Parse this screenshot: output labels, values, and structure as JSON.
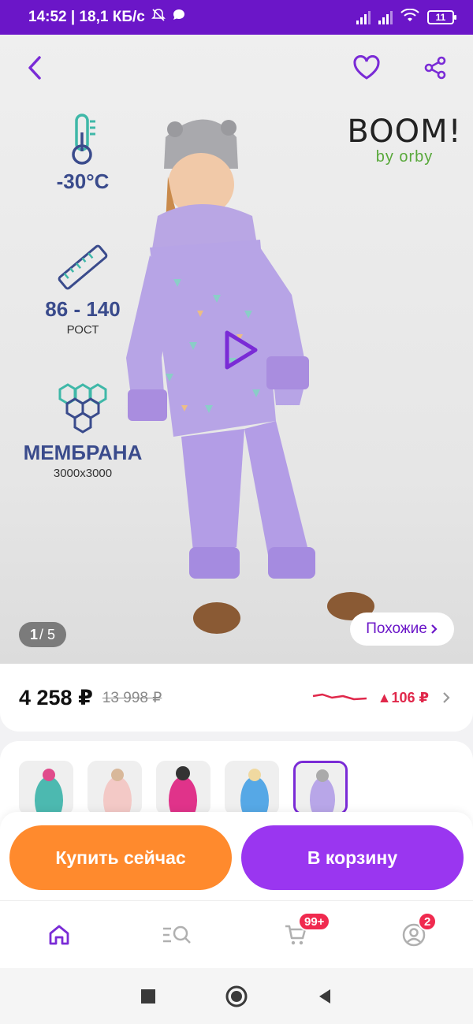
{
  "status_bar": {
    "time_speed": "14:52 | 18,1 КБ/с",
    "battery": "11"
  },
  "hero": {
    "brand_main": "BOOM!",
    "brand_sub": "by orby",
    "features": {
      "temperature": "-30°C",
      "height_range": "86 - 140",
      "height_label": "РОСТ",
      "membrane": "МЕМБРАНА",
      "membrane_spec": "3000x3000"
    },
    "counter_current": "1",
    "counter_total": "/ 5",
    "similar_label": "Похожие"
  },
  "price": {
    "current": "4 258 ₽",
    "old": "13 998 ₽",
    "trend_delta": "▲106 ₽"
  },
  "thumbnails": [
    {
      "color": "#4cb9b0",
      "active": false
    },
    {
      "color": "#f3c9c6",
      "active": false
    },
    {
      "color": "#e0338a",
      "active": false
    },
    {
      "color": "#56a8e6",
      "active": false
    },
    {
      "color": "#b8a6e8",
      "active": true
    }
  ],
  "actions": {
    "buy_now": "Купить сейчас",
    "add_to_cart": "В корзину"
  },
  "bottom_nav": {
    "cart_badge": "99+",
    "profile_badge": "2"
  },
  "colors": {
    "accent_purple": "#6b16c8",
    "buy_orange": "#ff8a2d",
    "cart_purple": "#9a36f0",
    "price_trend_red": "#e0284b"
  }
}
